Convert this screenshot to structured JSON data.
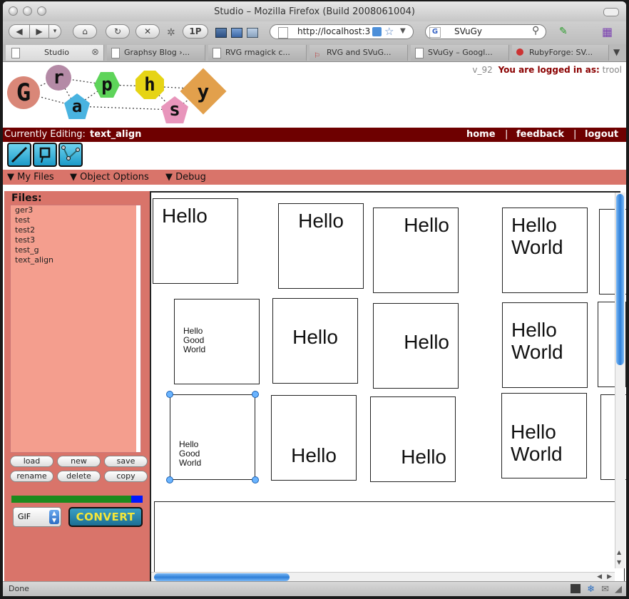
{
  "window": {
    "title": "Studio – Mozilla Firefox (Build 2008061004)"
  },
  "toolbar": {
    "url": "http://localhost:3",
    "search": "SVuGy",
    "onepass": "1P"
  },
  "tabs": [
    {
      "label": "Studio"
    },
    {
      "label": "Graphsy Blog ›..."
    },
    {
      "label": "RVG rmagick c..."
    },
    {
      "label": "RVG and SVuG..."
    },
    {
      "label": "SVuGy – Googl..."
    },
    {
      "label": "RubyForge: SV..."
    }
  ],
  "app": {
    "logo_letters": [
      "G",
      "r",
      "a",
      "p",
      "h",
      "s",
      "y"
    ],
    "version": "v_92",
    "logged_in_label": "You are logged in as:",
    "username": "trool",
    "editing_label": "Currently Editing:",
    "editing_file": "text_align",
    "nav": {
      "home": "home",
      "sep1": "|",
      "feedback": "feedback",
      "sep2": "|",
      "logout": "logout"
    },
    "menu": {
      "my_files": "My Files",
      "object_options": "Object Options",
      "debug": "Debug"
    },
    "files_heading": "Files:",
    "files": [
      "ger3",
      "test",
      "test2",
      "test3",
      "test_g",
      "text_align"
    ],
    "buttons": {
      "load": "load",
      "new": "new",
      "save": "save",
      "rename": "rename",
      "delete": "delete",
      "copy": "copy"
    },
    "format": "GIF",
    "convert": "CONVERT",
    "status": "Done"
  },
  "cards": {
    "hello": "Hello",
    "world": "World",
    "good": "Good"
  },
  "colors": {
    "accent": "#6e0000",
    "panel": "#d9746a",
    "files_bg": "#f49e8e",
    "convert_text": "#f3e63a"
  }
}
